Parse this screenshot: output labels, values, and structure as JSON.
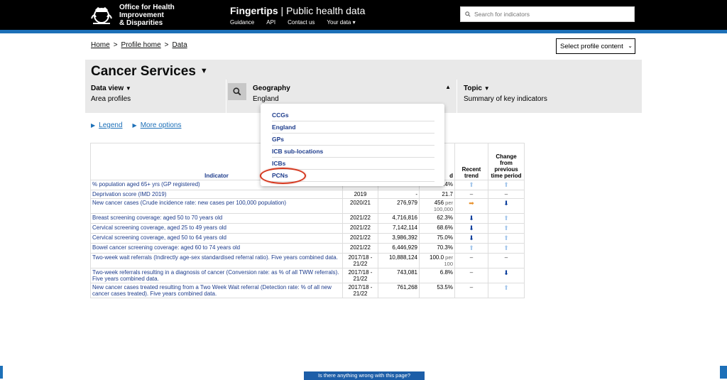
{
  "header": {
    "org_line1": "Office for Health",
    "org_line2": "Improvement",
    "org_line3": "& Disparities",
    "brand_bold": "Fingertips",
    "brand_rest": " | Public health data",
    "nav": [
      "Guidance",
      "API",
      "Contact us",
      "Your data ▾"
    ],
    "search_placeholder": "Search for indicators"
  },
  "breadcrumbs": [
    "Home",
    "Profile home",
    "Data"
  ],
  "select_profile": "Select profile content",
  "page_title": "Cancer Services",
  "data_view": {
    "label": "Data view",
    "value": "Area profiles"
  },
  "geography": {
    "label": "Geography",
    "value": "England"
  },
  "topic": {
    "label": "Topic",
    "value": "Summary of key indicators"
  },
  "links": {
    "legend": "Legend",
    "more": "More options"
  },
  "geo_dropdown": [
    "CCGs",
    "England",
    "GPs",
    "ICB sub-locations",
    "ICBs",
    "PCNs"
  ],
  "table": {
    "headers": {
      "indicator": "Indicator",
      "period": "",
      "count": "",
      "value": "d",
      "trend": "Recent trend",
      "change": "Change from previous time period"
    },
    "rows": [
      {
        "indicator": "% population aged 65+ yrs (GP registered)",
        "period": "",
        "count": "",
        "value": ".4%",
        "unit": "",
        "trend": "up-light",
        "change": "up-light"
      },
      {
        "indicator": "Deprivation score (IMD 2019)",
        "period": "2019",
        "count": "-",
        "value": "21.7",
        "unit": "",
        "trend": "dash",
        "change": "dash"
      },
      {
        "indicator": "New cancer cases (Crude incidence rate: new cases per 100,000 population)",
        "period": "2020/21",
        "count": "276,979",
        "value": "456",
        "unit": " per 100,000",
        "trend": "right-orange",
        "change": "down-dark"
      },
      {
        "indicator": "Breast screening coverage: aged 50 to 70 years old",
        "period": "2021/22",
        "count": "4,716,816",
        "value": "62.3%",
        "unit": "",
        "trend": "down-dark",
        "change": "up-light"
      },
      {
        "indicator": "Cervical screening coverage, aged 25 to 49 years old",
        "period": "2021/22",
        "count": "7,142,114",
        "value": "68.6%",
        "unit": "",
        "trend": "down-dark",
        "change": "up-light"
      },
      {
        "indicator": "Cervical screening coverage, aged 50 to 64 years old",
        "period": "2021/22",
        "count": "3,986,392",
        "value": "75.0%",
        "unit": "",
        "trend": "down-dark",
        "change": "up-light"
      },
      {
        "indicator": "Bowel cancer screening coverage: aged 60 to 74 years old",
        "period": "2021/22",
        "count": "6,446,929",
        "value": "70.3%",
        "unit": "",
        "trend": "up-light",
        "change": "up-light"
      },
      {
        "indicator": "Two-week wait referrals (Indirectly age-sex standardised referral ratio). Five years combined data.",
        "period": "2017/18 - 21/22",
        "count": "10,888,124",
        "value": "100.0",
        "unit": " per 100",
        "trend": "dash",
        "change": "dash"
      },
      {
        "indicator": "Two-week referrals resulting in a diagnosis of cancer (Conversion rate: as % of all TWW referrals). Five years combined data.",
        "period": "2017/18 - 21/22",
        "count": "743,081",
        "value": "6.8%",
        "unit": "",
        "trend": "dash",
        "change": "down-dark"
      },
      {
        "indicator": "New cancer cases treated resulting from a Two Week Wait referral (Detection rate: % of all new cancer cases treated). Five years combined data.",
        "period": "2017/18 - 21/22",
        "count": "761,268",
        "value": "53.5%",
        "unit": "",
        "trend": "dash",
        "change": "up-light"
      }
    ]
  },
  "footer_button": "Is there anything wrong with this page?"
}
